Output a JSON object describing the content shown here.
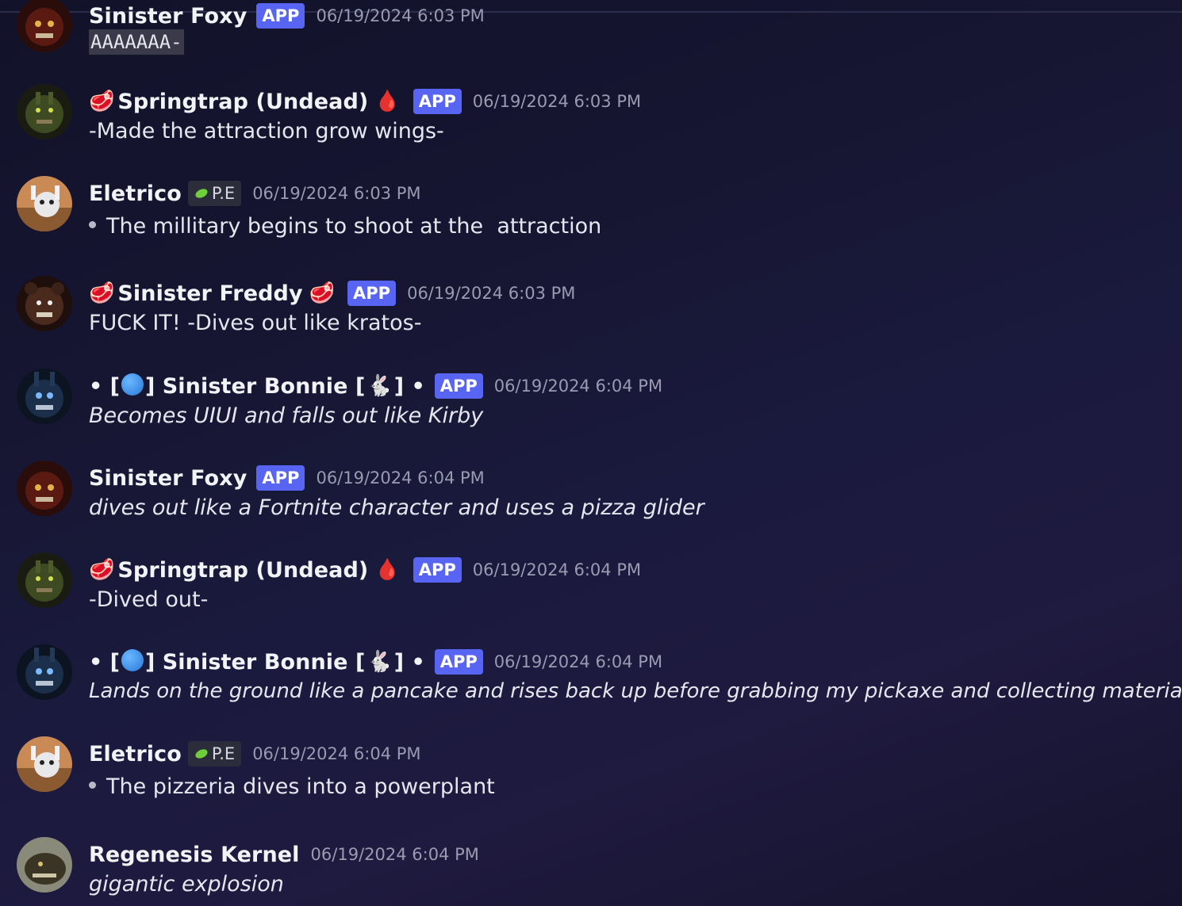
{
  "colors": {
    "app_badge": "#5865f2",
    "timestamp": "#9a9bb0",
    "username": "#f2f3f5"
  },
  "messages": [
    {
      "author": "Sinister Foxy",
      "badge": "APP",
      "time": "06/19/2024 6:03 PM",
      "text": "AAAAAAA-"
    },
    {
      "author": "Springtrap (Undead)",
      "prefix_emoji": "🥩",
      "suffix_emoji": "🩸",
      "badge": "APP",
      "time": "06/19/2024 6:03 PM",
      "text": "-Made the attraction grow wings-"
    },
    {
      "author": "Eletrico",
      "role_badge": "P.E",
      "role_icon": "leaf-icon",
      "time": "06/19/2024 6:03 PM",
      "text": "The millitary begins to shoot at the  attraction"
    },
    {
      "author": "Sinister Freddy",
      "prefix_emoji": "🥩",
      "suffix_emoji": "🥩",
      "badge": "APP",
      "time": "06/19/2024 6:03 PM",
      "text": "FUCK IT! -Dives out like kratos-"
    },
    {
      "author": "Sinister Bonnie",
      "name_prefix": "• [",
      "name_mid": "] ",
      "name_suffix": " [",
      "name_end": "] •",
      "emoji_rabbit": "🐇",
      "badge": "APP",
      "time": "06/19/2024 6:04 PM",
      "text": "Becomes UIUI and falls out like Kirby"
    },
    {
      "author": "Sinister Foxy",
      "badge": "APP",
      "time": "06/19/2024 6:04 PM",
      "text": "dives out like a Fortnite character and uses a pizza glider"
    },
    {
      "author": "Springtrap (Undead)",
      "prefix_emoji": "🥩",
      "suffix_emoji": "🩸",
      "badge": "APP",
      "time": "06/19/2024 6:04 PM",
      "text": "-Dived out-"
    },
    {
      "author": "Sinister Bonnie",
      "name_prefix": "• [",
      "name_mid": "] ",
      "name_suffix": " [",
      "name_end": "] •",
      "emoji_rabbit": "🐇",
      "badge": "APP",
      "time": "06/19/2024 6:04 PM",
      "text": "Lands on the ground like a pancake and rises back up before grabbing my pickaxe and collecting materials"
    },
    {
      "author": "Eletrico",
      "role_badge": "P.E",
      "role_icon": "leaf-icon",
      "time": "06/19/2024 6:04 PM",
      "text": "The pizzeria dives into a powerplant"
    },
    {
      "author": "Regenesis Kernel",
      "time": "06/19/2024 6:04 PM",
      "text": "gigantic explosion"
    }
  ]
}
